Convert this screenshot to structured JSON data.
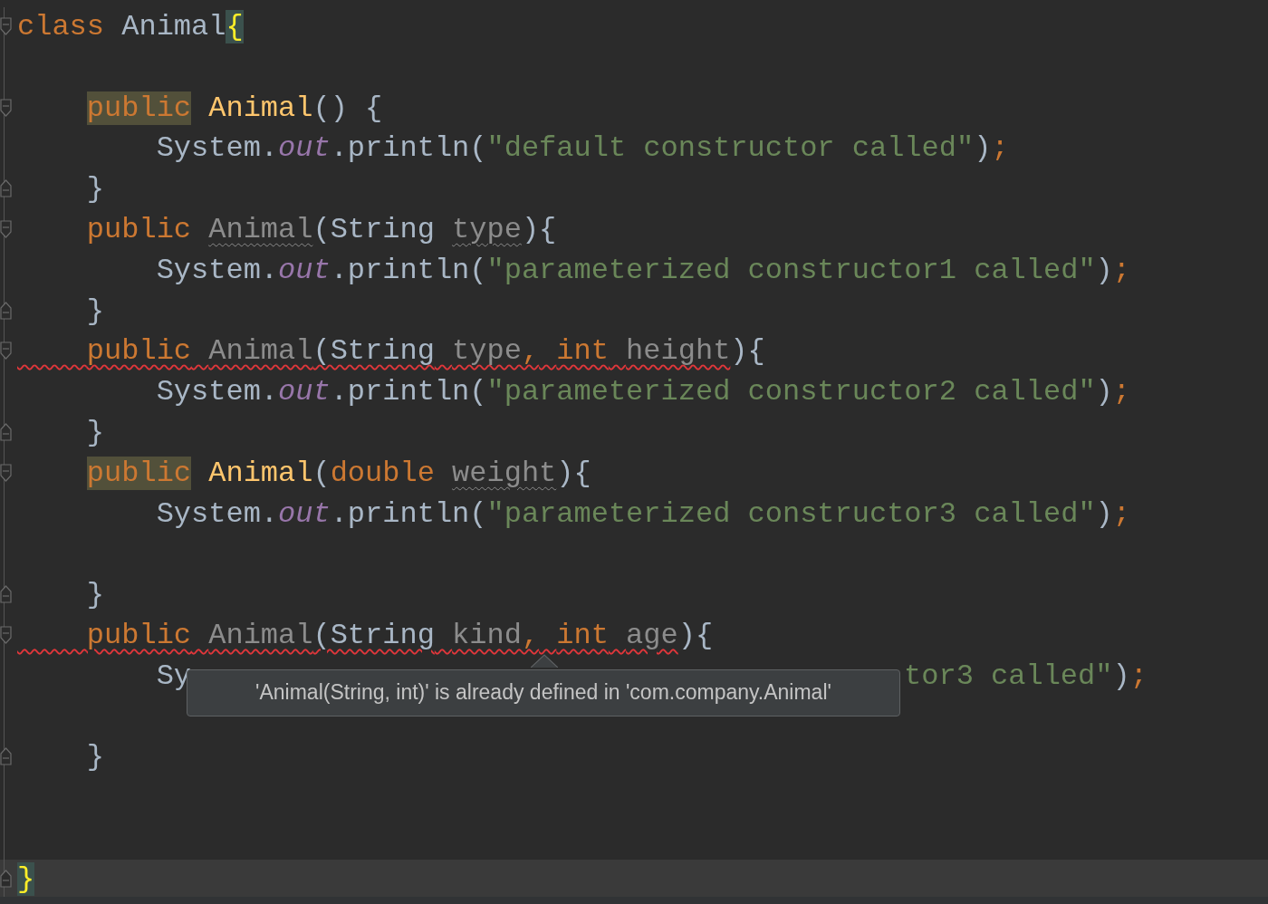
{
  "editor": {
    "lines": [
      {
        "fold_start": true,
        "current": false,
        "tokens": [
          {
            "text": "class ",
            "kind": "kw"
          },
          {
            "text": "Animal",
            "kind": "plain"
          },
          {
            "text": "{",
            "kind": "brace-match"
          }
        ]
      },
      {
        "current": false
      },
      {
        "fold_start": true,
        "current": false,
        "tokens": [
          {
            "text": "    public ",
            "kind": "kw-hl"
          },
          {
            "text": "Animal",
            "kind": "decl"
          },
          {
            "text": "() {",
            "kind": "plain"
          }
        ]
      },
      {
        "current": false,
        "tokens": [
          {
            "text": "        System.",
            "kind": "plain"
          },
          {
            "text": "out",
            "kind": "field"
          },
          {
            "text": ".println(",
            "kind": "plain"
          },
          {
            "text": "\"default constructor called\"",
            "kind": "str"
          },
          {
            "text": ")",
            "kind": "plain"
          },
          {
            "text": ";",
            "kind": "punct"
          }
        ]
      },
      {
        "fold_end": true,
        "current": false,
        "tokens": [
          {
            "text": "    }",
            "kind": "plain"
          }
        ]
      },
      {
        "fold_start": true,
        "current": false,
        "tokens": [
          {
            "text": "    public ",
            "kind": "kw"
          },
          {
            "text": "Animal",
            "kind": "unused"
          },
          {
            "text": "(String ",
            "kind": "plain"
          },
          {
            "text": "type",
            "kind": "unused"
          },
          {
            "text": "){",
            "kind": "plain"
          }
        ]
      },
      {
        "current": false,
        "tokens": [
          {
            "text": "        System.",
            "kind": "plain"
          },
          {
            "text": "out",
            "kind": "field"
          },
          {
            "text": ".println(",
            "kind": "plain"
          },
          {
            "text": "\"parameterized constructor1 called\"",
            "kind": "str"
          },
          {
            "text": ")",
            "kind": "plain"
          },
          {
            "text": ";",
            "kind": "punct"
          }
        ]
      },
      {
        "fold_end": true,
        "current": false,
        "tokens": [
          {
            "text": "    }",
            "kind": "plain"
          }
        ]
      },
      {
        "fold_start": true,
        "current": false,
        "tokens": [
          {
            "text": "    public ",
            "kind": "kw",
            "error": true
          },
          {
            "text": "Animal",
            "kind": "unused",
            "error": true
          },
          {
            "text": "(String ",
            "kind": "plain",
            "error": true
          },
          {
            "text": "type",
            "kind": "unused",
            "error": true
          },
          {
            "text": ", ",
            "kind": "punct",
            "error": true
          },
          {
            "text": "int ",
            "kind": "kw",
            "error": true
          },
          {
            "text": "height",
            "kind": "unused",
            "error": true
          },
          {
            "text": "){",
            "kind": "plain"
          }
        ]
      },
      {
        "current": false,
        "tokens": [
          {
            "text": "        System.",
            "kind": "plain"
          },
          {
            "text": "out",
            "kind": "field"
          },
          {
            "text": ".println(",
            "kind": "plain"
          },
          {
            "text": "\"parameterized constructor2 called\"",
            "kind": "str"
          },
          {
            "text": ")",
            "kind": "plain"
          },
          {
            "text": ";",
            "kind": "punct"
          }
        ]
      },
      {
        "fold_end": true,
        "current": false,
        "tokens": [
          {
            "text": "    }",
            "kind": "plain"
          }
        ]
      },
      {
        "fold_start": true,
        "current": false,
        "tokens": [
          {
            "text": "    public ",
            "kind": "kw-hl"
          },
          {
            "text": "Animal",
            "kind": "decl"
          },
          {
            "text": "(",
            "kind": "plain"
          },
          {
            "text": "double ",
            "kind": "kw"
          },
          {
            "text": "weight",
            "kind": "unused"
          },
          {
            "text": "){",
            "kind": "plain"
          }
        ]
      },
      {
        "current": false,
        "tokens": [
          {
            "text": "        System.",
            "kind": "plain"
          },
          {
            "text": "out",
            "kind": "field"
          },
          {
            "text": ".println(",
            "kind": "plain"
          },
          {
            "text": "\"parameterized constructor3 called\"",
            "kind": "str"
          },
          {
            "text": ")",
            "kind": "plain"
          },
          {
            "text": ";",
            "kind": "punct"
          }
        ]
      },
      {
        "current": false
      },
      {
        "fold_end": true,
        "current": false,
        "tokens": [
          {
            "text": "    }",
            "kind": "plain"
          }
        ]
      },
      {
        "fold_start": true,
        "current": false,
        "tokens": [
          {
            "text": "    public ",
            "kind": "kw",
            "error": true
          },
          {
            "text": "Animal",
            "kind": "unused",
            "error": true
          },
          {
            "text": "(String ",
            "kind": "plain",
            "error": true
          },
          {
            "text": "kind",
            "kind": "unused",
            "error": true
          },
          {
            "text": ", ",
            "kind": "punct",
            "error": true
          },
          {
            "text": "int ",
            "kind": "kw",
            "error": true
          },
          {
            "text": "age",
            "kind": "unused",
            "error": true
          },
          {
            "text": "){",
            "kind": "plain"
          }
        ]
      },
      {
        "current": false,
        "tokens": [
          {
            "text": "        Sy",
            "kind": "plain"
          }
        ],
        "after_tooltip": [
          {
            "text": "tor3 called\"",
            "kind": "str"
          },
          {
            "text": ")",
            "kind": "plain"
          },
          {
            "text": ";",
            "kind": "punct"
          }
        ]
      },
      {
        "current": false
      },
      {
        "fold_end": true,
        "current": false,
        "tokens": [
          {
            "text": "    }",
            "kind": "plain"
          }
        ]
      },
      {
        "current": false
      },
      {
        "current": false
      },
      {
        "fold_end": true,
        "current": true,
        "tokens": [
          {
            "text": "}",
            "kind": "brace-match"
          }
        ]
      }
    ],
    "tooltip": {
      "text": "'Animal(String, int)' is already defined in 'com.company.Animal'"
    }
  }
}
